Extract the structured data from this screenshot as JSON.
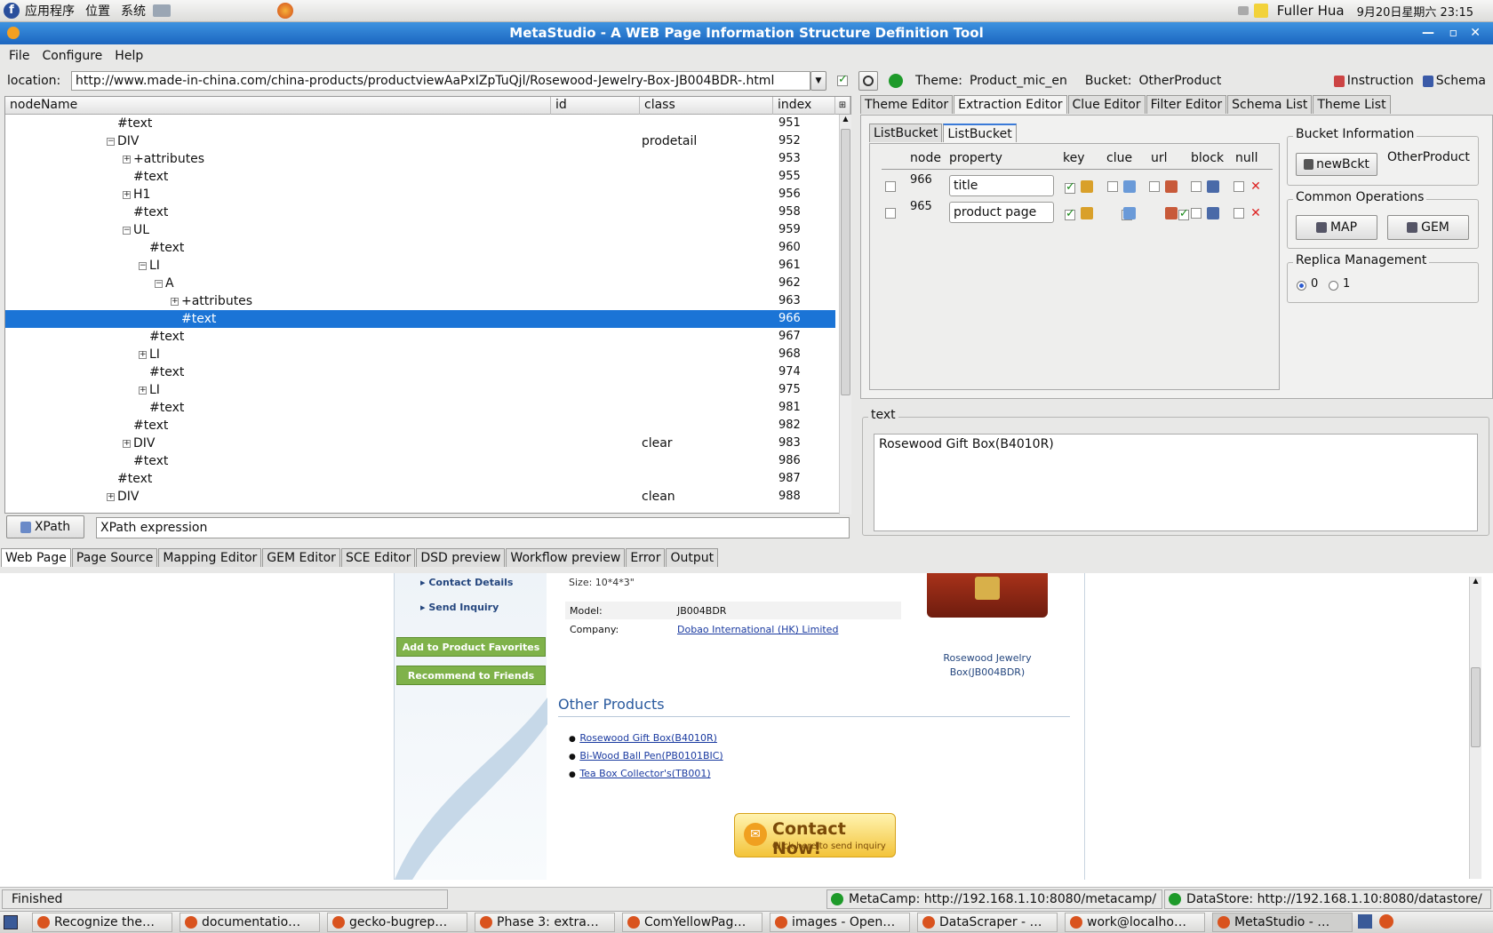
{
  "topbar": {
    "apps": "应用程序",
    "places": "位置",
    "system": "系统",
    "user": "Fuller Hua",
    "datetime": "9月20日星期六 23:15"
  },
  "window": {
    "title": "MetaStudio - A WEB Page Information Structure Definition Tool"
  },
  "menu": [
    "File",
    "Configure",
    "Help"
  ],
  "locbar": {
    "label": "location:",
    "url": "http://www.made-in-china.com/china-products/productviewAaPxIZpTuQjl/Rosewood-Jewelry-Box-JB004BDR-.html",
    "theme_label": "Theme:",
    "theme": "Product_mic_en",
    "bucket_label": "Bucket:",
    "bucket": "OtherProduct",
    "instruction": "Instruction",
    "schema": "Schema"
  },
  "tree": {
    "columns": [
      "nodeName",
      "id",
      "class",
      "index"
    ],
    "rows": [
      {
        "name": "#text",
        "class": "",
        "index": "951",
        "indent": 0,
        "exp": ""
      },
      {
        "name": "DIV",
        "class": "prodetail",
        "index": "952",
        "indent": 0,
        "exp": "-"
      },
      {
        "name": "+attributes",
        "class": "",
        "index": "953",
        "indent": 1,
        "exp": "+"
      },
      {
        "name": "#text",
        "class": "",
        "index": "955",
        "indent": 1,
        "exp": ""
      },
      {
        "name": "H1",
        "class": "",
        "index": "956",
        "indent": 1,
        "exp": "+"
      },
      {
        "name": "#text",
        "class": "",
        "index": "958",
        "indent": 1,
        "exp": ""
      },
      {
        "name": "UL",
        "class": "",
        "index": "959",
        "indent": 1,
        "exp": "-"
      },
      {
        "name": "#text",
        "class": "",
        "index": "960",
        "indent": 2,
        "exp": ""
      },
      {
        "name": "LI",
        "class": "",
        "index": "961",
        "indent": 2,
        "exp": "-"
      },
      {
        "name": "A",
        "class": "",
        "index": "962",
        "indent": 3,
        "exp": "-"
      },
      {
        "name": "+attributes",
        "class": "",
        "index": "963",
        "indent": 4,
        "exp": "+"
      },
      {
        "name": "#text",
        "class": "",
        "index": "966",
        "indent": 4,
        "exp": "",
        "selected": true
      },
      {
        "name": "#text",
        "class": "",
        "index": "967",
        "indent": 2,
        "exp": ""
      },
      {
        "name": "LI",
        "class": "",
        "index": "968",
        "indent": 2,
        "exp": "+"
      },
      {
        "name": "#text",
        "class": "",
        "index": "974",
        "indent": 2,
        "exp": ""
      },
      {
        "name": "LI",
        "class": "",
        "index": "975",
        "indent": 2,
        "exp": "+"
      },
      {
        "name": "#text",
        "class": "",
        "index": "981",
        "indent": 2,
        "exp": ""
      },
      {
        "name": "#text",
        "class": "",
        "index": "982",
        "indent": 1,
        "exp": ""
      },
      {
        "name": "DIV",
        "class": "clear",
        "index": "983",
        "indent": 1,
        "exp": "+"
      },
      {
        "name": "#text",
        "class": "",
        "index": "986",
        "indent": 1,
        "exp": ""
      },
      {
        "name": "#text",
        "class": "",
        "index": "987",
        "indent": 0,
        "exp": ""
      },
      {
        "name": "DIV",
        "class": "clean",
        "index": "988",
        "indent": 0,
        "exp": "+"
      }
    ]
  },
  "xpath": {
    "button": "XPath",
    "value": "XPath expression"
  },
  "right_tabs": [
    "Theme Editor",
    "Extraction Editor",
    "Clue Editor",
    "Filter Editor",
    "Schema List",
    "Theme List"
  ],
  "bucket_tabs": [
    "ListBucket",
    "ListBucket"
  ],
  "grid": {
    "columns": [
      "node",
      "property",
      "key",
      "clue",
      "url",
      "block",
      "null"
    ],
    "rows": [
      {
        "node": "966",
        "property": "title",
        "key": true,
        "clue": false,
        "url": false
      },
      {
        "node": "965",
        "property": "product page",
        "key": true,
        "clue": true,
        "url": true
      }
    ]
  },
  "bucket_info": {
    "legend": "Bucket Information",
    "new_button": "newBckt",
    "name": "OtherProduct"
  },
  "common_ops": {
    "legend": "Common Operations",
    "map": "MAP",
    "gem": "GEM"
  },
  "replica": {
    "legend": "Replica Management",
    "opt0": "0",
    "opt1": "1"
  },
  "text_panel": {
    "legend": "text",
    "value": "Rosewood Gift Box(B4010R)"
  },
  "bottom_tabs": [
    "Web Page",
    "Page Source",
    "Mapping Editor",
    "GEM Editor",
    "SCE Editor",
    "DSD preview",
    "Workflow preview",
    "Error",
    "Output"
  ],
  "webpage": {
    "nav": [
      "Contact Details",
      "Send Inquiry"
    ],
    "buttons": [
      "Add to Product Favorites",
      "Recommend to Friends"
    ],
    "size": "Size: 10*4*3\"",
    "model_label": "Model:",
    "model": "JB004BDR",
    "company_label": "Company:",
    "company": "Dobao International (HK) Limited",
    "caption": "Rosewood Jewelry Box(JB004BDR)",
    "other_title": "Other Products",
    "others": [
      "Rosewood Gift Box(B4010R)",
      "Bi-Wood Ball Pen(PB0101BIC)",
      "Tea Box Collector's(TB001)"
    ],
    "contact_main": "Contact Now!",
    "contact_sub": "Click here to send inquiry"
  },
  "status": {
    "text": "Finished",
    "metacamp": "MetaCamp: http://192.168.1.10:8080/metacamp/",
    "datastore": "DataStore: http://192.168.1.10:8080/datastore/"
  },
  "taskbar": [
    "Recognize the…",
    "documentatio…",
    "gecko-bugrep…",
    "Phase 3: extra…",
    "ComYellowPag…",
    "images - Open…",
    "DataScraper - …",
    "work@localho…",
    "MetaStudio - …"
  ],
  "colors": {
    "selection": "#1b74d6",
    "titlebar": "#1c66c0",
    "accent_green": "#7fb24a"
  }
}
